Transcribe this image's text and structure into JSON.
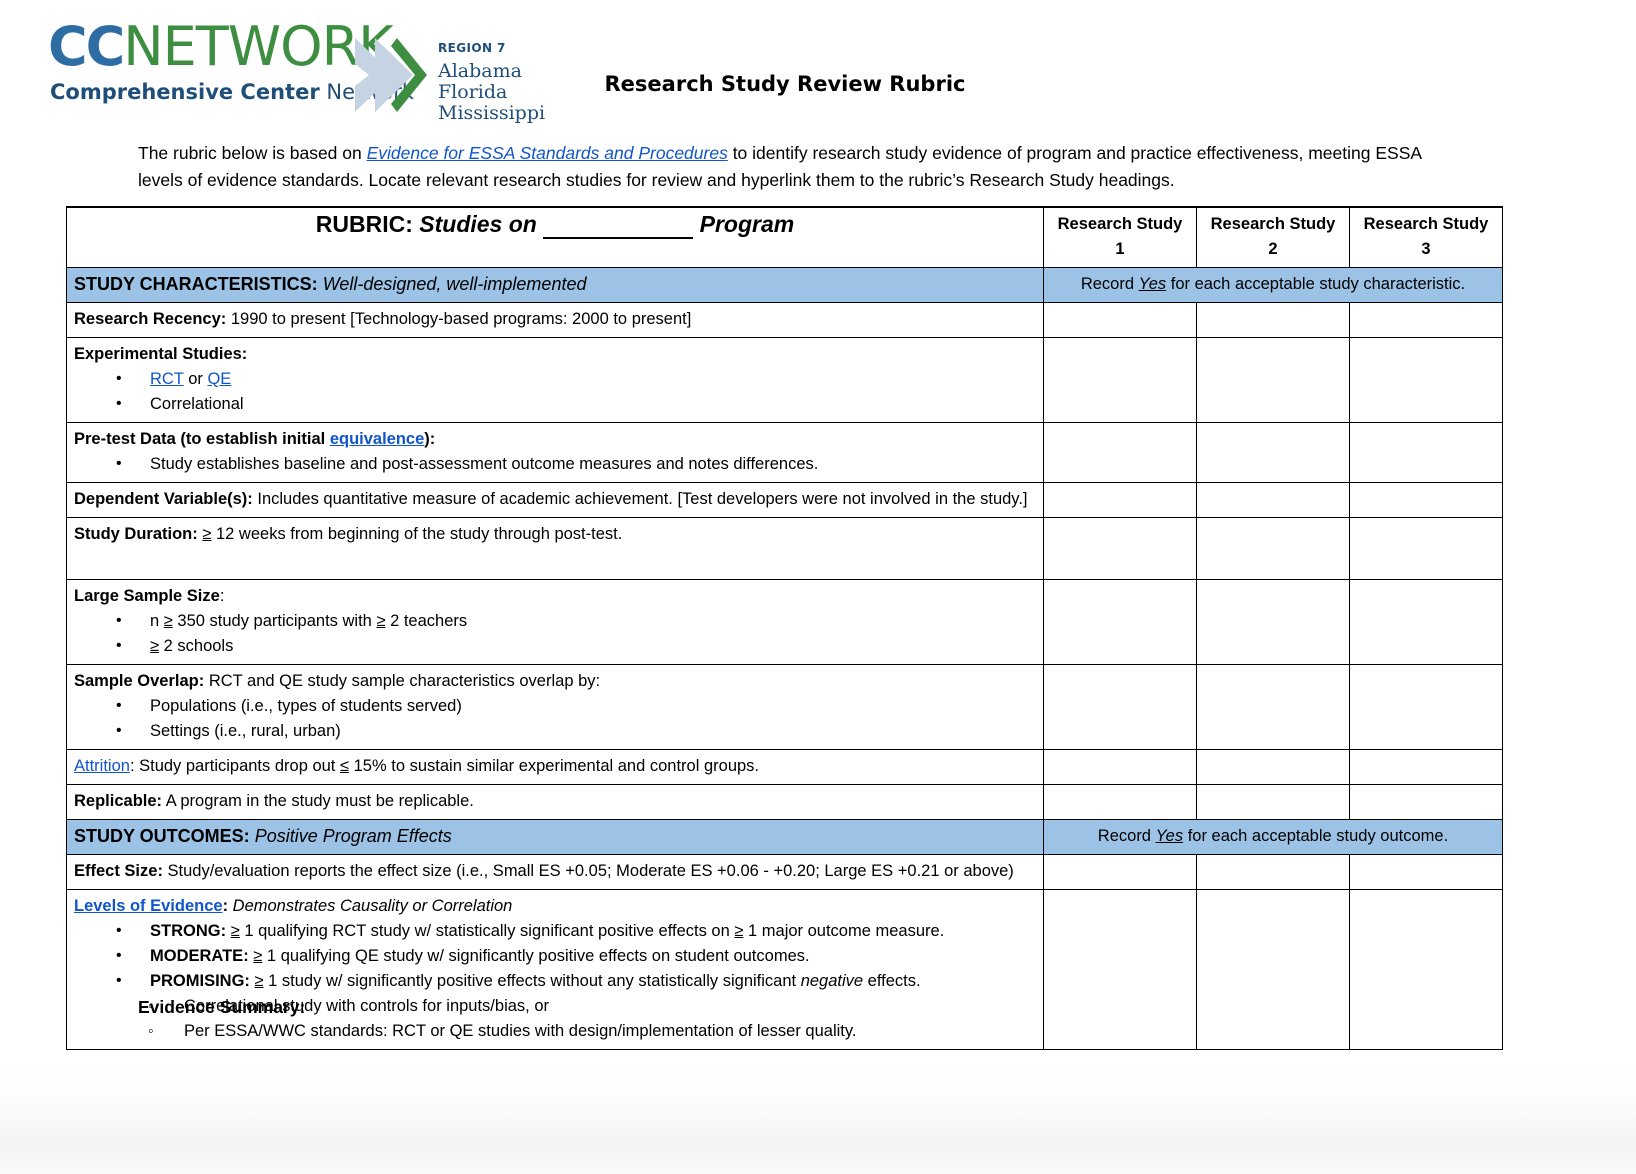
{
  "logo": {
    "cc": "CC",
    "network": "NETWORK",
    "tagline_bold": "Comprehensive Center",
    "tagline_normal": "Network",
    "region_label": "REGION 7",
    "states": [
      "Alabama",
      "Florida",
      "Mississippi"
    ],
    "brand_blue": "#2E6DA4",
    "brand_green": "#3E8E41",
    "chevron_gray": "#C5D3E2"
  },
  "header": {
    "title": "Research Study Review Rubric"
  },
  "intro": {
    "part1": "The rubric below is based on ",
    "link": "Evidence for ESSA Standards and Procedures",
    "part2": " to identify research study evidence of program and practice effectiveness, meeting ESSA levels of evidence standards. Locate relevant research studies for review and hyperlink them to the rubric’s Research Study headings."
  },
  "table": {
    "title_prefix": "RUBRIC:",
    "title_italic_pre": "Studies on",
    "title_italic_post": "Program",
    "study_columns": [
      {
        "line1": "Research Study",
        "line2": "1"
      },
      {
        "line1": "Research Study",
        "line2": "2"
      },
      {
        "line1": "Research Study",
        "line2": "3"
      }
    ],
    "band_color": "#9CC3E5",
    "section1": {
      "label_bold": "STUDY CHARACTERISTICS:",
      "label_italic": " Well-designed, well-implemented",
      "note_pre": "Record ",
      "note_em": "Yes",
      "note_post": " for each acceptable study characteristic."
    },
    "section2": {
      "label_bold": "STUDY OUTCOMES:",
      "label_italic": " Positive Program Effects",
      "note_pre": "Record ",
      "note_em": "Yes",
      "note_post": " for each acceptable study outcome."
    },
    "rows": {
      "recency": {
        "bold": "Research Recency:",
        "text": " 1990 to present [Technology-based programs: 2000 to present]"
      },
      "experimental": {
        "bold": "Experimental Studies:",
        "bullet1_link1": "RCT",
        "bullet1_mid": " or ",
        "bullet1_link2": "QE",
        "bullet2": "Correlational"
      },
      "pretest": {
        "bold_pre": "Pre-test Data (to establish initial ",
        "link": "equivalence",
        "bold_post": "):",
        "bullet1": "Study establishes baseline and post-assessment outcome measures and notes differences."
      },
      "dependent": {
        "bold": "Dependent Variable(s):",
        "text": " Includes quantitative measure of academic achievement. [Test developers were not involved in the study.]"
      },
      "duration": {
        "bold": "Study Duration:",
        "ge": "≥",
        "text": " 12 weeks from beginning of the study through post-test."
      },
      "sample_size": {
        "bold": "Large Sample Size",
        "colon": ":",
        "bullet1_a": "n ",
        "bullet1_ge1": "≥",
        "bullet1_b": " 350 study participants with ",
        "bullet1_ge2": "≥",
        "bullet1_c": " 2 teachers",
        "bullet2_ge": "≥",
        "bullet2_text": " 2 schools"
      },
      "overlap": {
        "bold": "Sample Overlap:",
        "text": " RCT and QE study sample characteristics overlap by:",
        "bullet1": "Populations (i.e., types of students served)",
        "bullet2": "Settings (i.e., rural, urban)"
      },
      "attrition": {
        "link": "Attrition",
        "text_a": ": Study participants drop out ",
        "le": "≤",
        "text_b": " 15% to sustain similar experimental and control groups."
      },
      "replicable": {
        "bold": "Replicable:",
        "text": " A program in the study must be replicable."
      },
      "effect_size": {
        "bold": "Effect Size:",
        "text": " Study/evaluation reports the effect size (i.e., Small ES +0.05; Moderate ES +0.06 - +0.20; Large ES +0.21 or above)"
      },
      "levels": {
        "link": "Levels of Evidence",
        "colon": ":",
        "italic": " Demonstrates Causality or Correlation",
        "strong_label": "STRONG:",
        "strong_ge": "≥",
        "strong_a": " 1 qualifying RCT study w/ statistically significant positive effects on ",
        "strong_ge2": "≥",
        "strong_b": " 1 major outcome measure.",
        "moderate_label": "MODERATE:",
        "moderate_ge": "≥",
        "moderate_text": " 1 qualifying QE study w/ significantly positive effects on student outcomes.",
        "promising_label": "PROMISING:",
        "promising_ge": "≥",
        "promising_a": " 1 study w/ significantly positive effects without any statistically significant ",
        "promising_em": "negative",
        "promising_b": " effects.",
        "sub1": "Correlational study with controls for inputs/bias, or",
        "sub2": "Per ESSA/WWC standards: RCT or QE studies with design/implementation of lesser quality."
      }
    }
  },
  "footer": {
    "evidence_summary": "Evidence Summary:"
  }
}
